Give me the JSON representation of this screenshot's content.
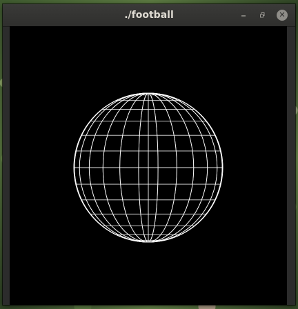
{
  "window": {
    "title": "./football",
    "controls": {
      "minimize_icon": "minimize-icon",
      "restore_icon": "restore-icon",
      "close_icon": "close-icon"
    }
  },
  "canvas": {
    "background": "#000000",
    "sphere": {
      "color": "#ffffff",
      "parallel_count": 14,
      "meridian_count": 24
    }
  }
}
